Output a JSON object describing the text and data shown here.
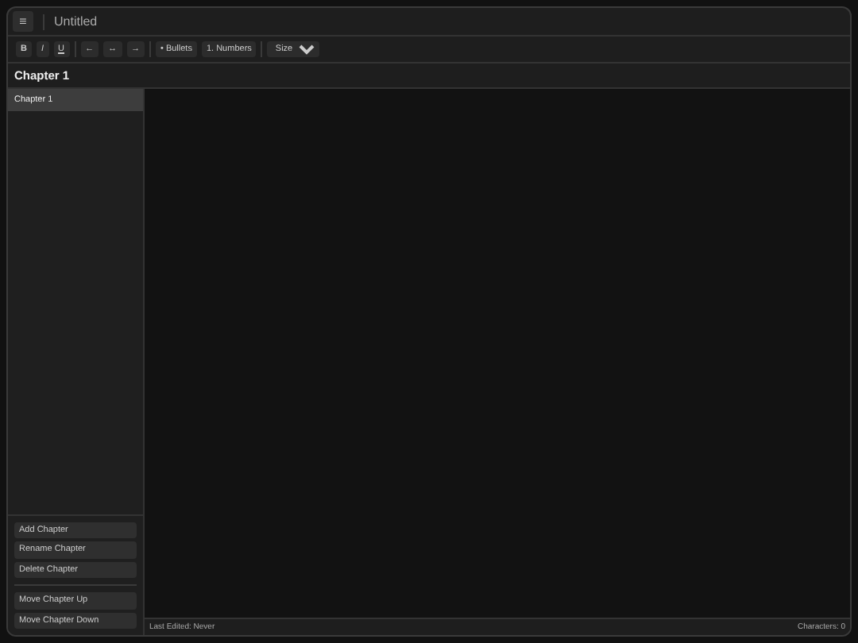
{
  "header": {
    "menu_icon": "≡",
    "title": "Untitled"
  },
  "toolbar": {
    "format_buttons": [
      "B",
      "I",
      "U"
    ],
    "align_buttons": [
      "←",
      "↔",
      "→"
    ],
    "list_buttons": [
      "• Bullets",
      "1. Numbers"
    ],
    "size_select": "Size"
  },
  "chapter_title": "Chapter 1",
  "sidebar": {
    "items": [
      {
        "label": "Chapter 1",
        "selected": true
      }
    ],
    "action_groups": [
      [
        "Add Chapter",
        "Rename Chapter",
        "Delete Chapter"
      ],
      [
        "Move Chapter Up",
        "Move Chapter Down"
      ]
    ]
  },
  "status_bar": {
    "last_edited": "Last Edited: Never",
    "characters": "Characters: 0"
  }
}
